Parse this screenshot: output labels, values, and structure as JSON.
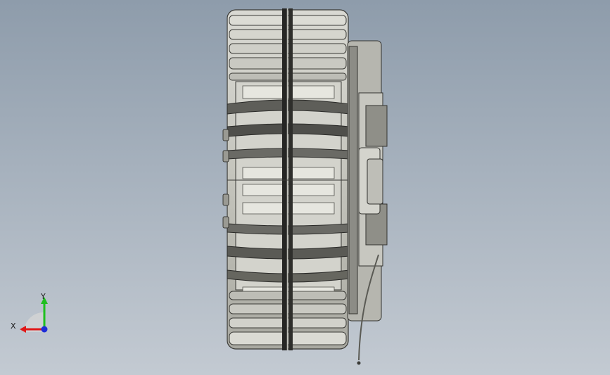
{
  "viewport": {
    "background_top": "#8e9cab",
    "background_bottom": "#c3cad2"
  },
  "model": {
    "description_icon": "brake-cad-model",
    "body_color": "#c9c9c2",
    "shadow_color": "#5a5a55",
    "groove_color": "#2a2a2a"
  },
  "triad": {
    "x_label": "X",
    "y_label": "Y",
    "x_color": "#e01818",
    "y_color": "#1fbf1f",
    "z_color": "#1e2cd8"
  }
}
